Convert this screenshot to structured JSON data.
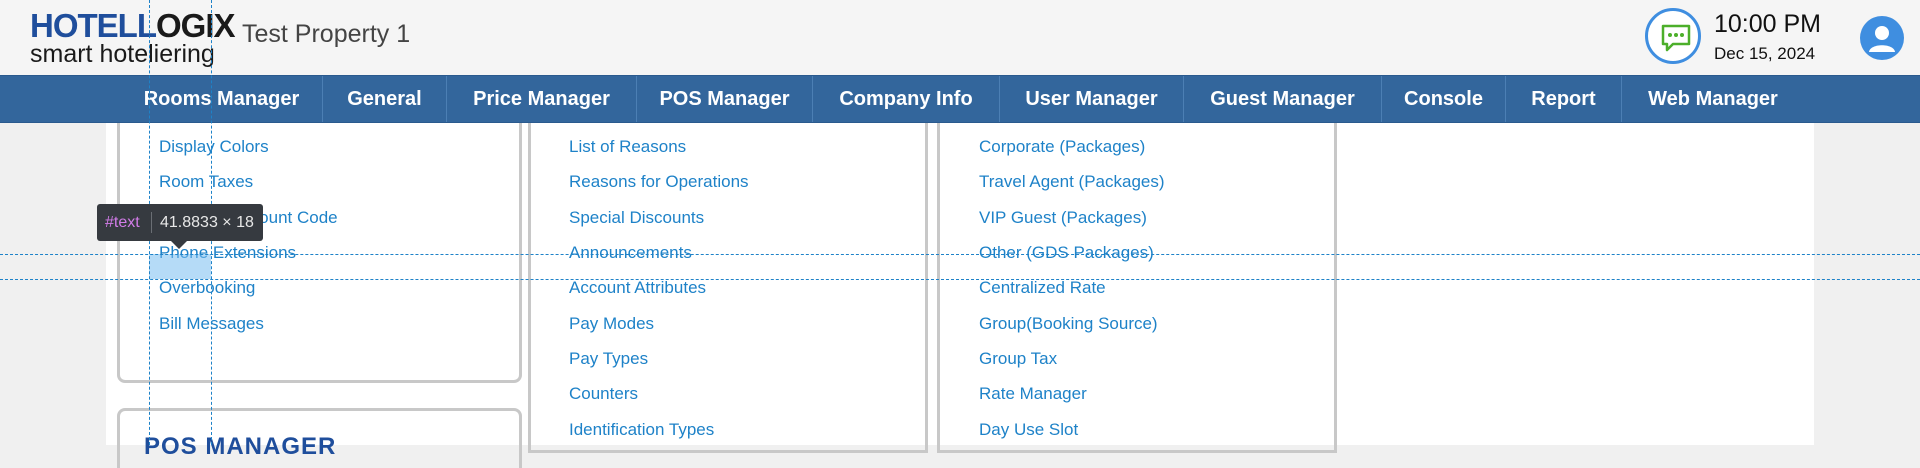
{
  "header": {
    "logo_primary_a": "HOTEL",
    "logo_primary_b": "OGIX",
    "logo_primary_l": "L",
    "logo_tagline": "smart hoteliering",
    "property_name": "Test Property 1",
    "time": "10:00 PM",
    "date": "Dec 15, 2024",
    "icons": {
      "chat": "chat-bubble-icon",
      "user": "user-avatar-icon"
    },
    "accent_color": "#3f8ee0"
  },
  "nav": {
    "items": [
      "Rooms Manager",
      "General",
      "Price Manager",
      "POS Manager",
      "Company Info",
      "User Manager",
      "Guest Manager",
      "Console",
      "Report",
      "Web Manager"
    ],
    "background": "#33669c"
  },
  "menu": {
    "column1": {
      "links": [
        "Display Colors",
        "Room Taxes",
        "Revenue Account Code",
        "Phone Extensions",
        "Overbooking",
        "Bill Messages"
      ],
      "section_heading": "POS MANAGER"
    },
    "column2": {
      "links": [
        "List of Reasons",
        "Reasons for Operations",
        "Special Discounts",
        "Announcements",
        "Account Attributes",
        "Pay Modes",
        "Pay Types",
        "Counters",
        "Identification Types"
      ]
    },
    "column3": {
      "links": [
        "Corporate (Packages)",
        "Travel Agent (Packages)",
        "VIP Guest (Packages)",
        "Other (GDS Packages)",
        "Centralized Rate",
        "Group(Booking Source)",
        "Group Tax",
        "Rate Manager",
        "Day Use Slot"
      ]
    },
    "link_color": "#1e82c8"
  },
  "inspector": {
    "tag": "#text",
    "size": "41.8833 × 18"
  }
}
